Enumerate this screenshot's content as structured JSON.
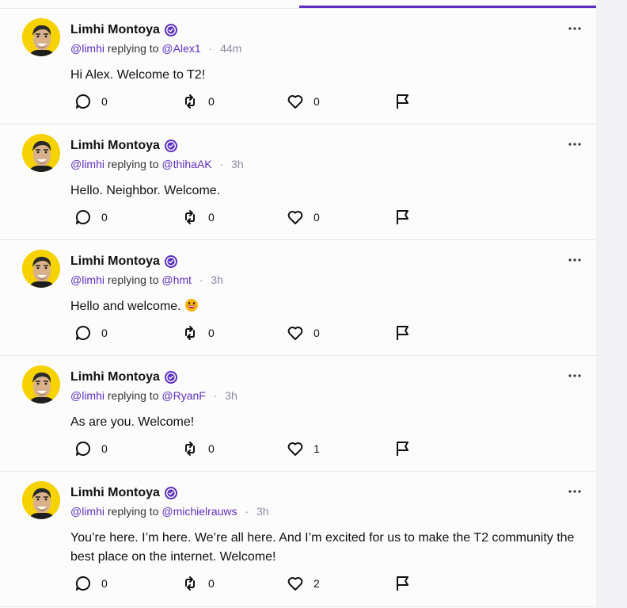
{
  "posts": [
    {
      "name": "Limhi Montoya",
      "handle": "@limhi",
      "replying_label": "replying to",
      "reply_to": "@Alex1",
      "time": "44m",
      "body": "Hi Alex. Welcome to T2!",
      "comments": "0",
      "reposts": "0",
      "likes": "0"
    },
    {
      "name": "Limhi Montoya",
      "handle": "@limhi",
      "replying_label": "replying to",
      "reply_to": "@thihaAK",
      "time": "3h",
      "body": "Hello. Neighbor. Welcome.",
      "comments": "0",
      "reposts": "0",
      "likes": "0"
    },
    {
      "name": "Limhi Montoya",
      "handle": "@limhi",
      "replying_label": "replying to",
      "reply_to": "@hmt",
      "time": "3h",
      "body": "Hello and welcome.",
      "emoji": "grinning-face",
      "comments": "0",
      "reposts": "0",
      "likes": "0"
    },
    {
      "name": "Limhi Montoya",
      "handle": "@limhi",
      "replying_label": "replying to",
      "reply_to": "@RyanF",
      "time": "3h",
      "body": "As are you. Welcome!",
      "comments": "0",
      "reposts": "0",
      "likes": "1"
    },
    {
      "name": "Limhi Montoya",
      "handle": "@limhi",
      "replying_label": "replying to",
      "reply_to": "@michielrauws",
      "time": "3h",
      "body": "You’re here. I’m here. We’re all here. And I’m excited for us to make the T2 community the best place on the internet. Welcome!",
      "comments": "0",
      "reposts": "0",
      "likes": "2"
    }
  ],
  "colors": {
    "accent": "#5b2fbf",
    "avatar_bg": "#f6d200",
    "muted": "#8a8aa0"
  },
  "icons": [
    "verified-badge-icon",
    "more-options-icon",
    "comment-icon",
    "repost-icon",
    "like-icon",
    "flag-icon"
  ]
}
